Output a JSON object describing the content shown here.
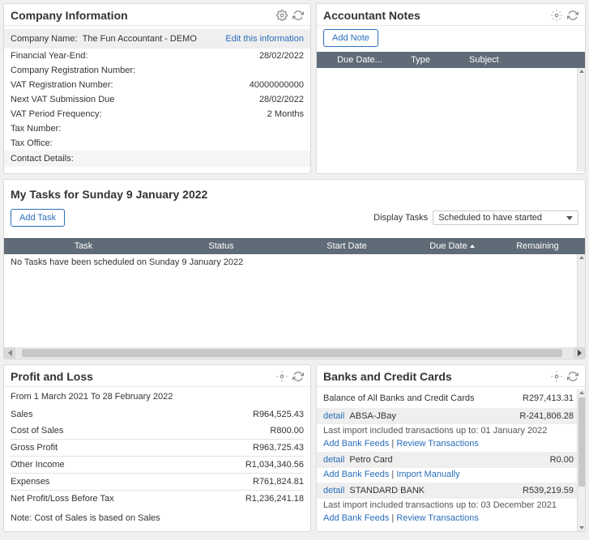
{
  "companyInfo": {
    "title": "Company Information",
    "nameLabel": "Company Name:",
    "nameValue": "The Fun Accountant - DEMO",
    "editLink": "Edit this information",
    "rows": [
      {
        "label": "Financial Year-End:",
        "value": "28/02/2022"
      },
      {
        "label": "Company Registration Number:",
        "value": ""
      },
      {
        "label": "VAT Registration Number:",
        "value": "40000000000"
      },
      {
        "label": "Next VAT Submission Due",
        "value": "28/02/2022"
      },
      {
        "label": "VAT Period Frequency:",
        "value": "2 Months"
      },
      {
        "label": "Tax Number:",
        "value": ""
      },
      {
        "label": "Tax Office:",
        "value": ""
      },
      {
        "label": "Contact Details:",
        "value": ""
      }
    ]
  },
  "accountantNotes": {
    "title": "Accountant Notes",
    "addNote": "Add Note",
    "columns": {
      "dueDate": "Due Date...",
      "type": "Type",
      "subject": "Subject"
    }
  },
  "tasks": {
    "title": "My Tasks for Sunday 9 January 2022",
    "addTask": "Add Task",
    "displayLabel": "Display Tasks",
    "displayValue": "Scheduled to have started",
    "columns": {
      "task": "Task",
      "status": "Status",
      "startDate": "Start Date",
      "dueDate": "Due Date",
      "remaining": "Remaining"
    },
    "empty": "No Tasks have been scheduled on Sunday 9 January 2022"
  },
  "pl": {
    "title": "Profit and Loss",
    "period": "From 1 March 2021 To 28 February 2022",
    "lines": {
      "sales": {
        "label": "Sales",
        "value": "R964,525.43"
      },
      "cos": {
        "label": "Cost of Sales",
        "value": "R800.00"
      },
      "gross": {
        "label": "Gross Profit",
        "value": "R963,725.43"
      },
      "other": {
        "label": "Other Income",
        "value": "R1,034,340.56"
      },
      "exp": {
        "label": "Expenses",
        "value": "R761,824.81"
      },
      "net": {
        "label": "Net Profit/Loss Before Tax",
        "value": "R1,236,241.18"
      }
    },
    "note": "Note: Cost of Sales is based on Sales"
  },
  "banks": {
    "title": "Banks and Credit Cards",
    "balanceLabel": "Balance of All Banks and Credit Cards",
    "balanceValue": "R297,413.31",
    "detailLabel": "detail",
    "addBankFeeds": "Add Bank Feeds",
    "reviewTx": "Review Transactions",
    "importManually": "Import Manually",
    "sep": " | ",
    "accounts": [
      {
        "name": "ABSA-JBay",
        "value": "R-241,806.28",
        "sub": "Last import included transactions up to: 01 January 2022",
        "actions": "review"
      },
      {
        "name": "Petro Card",
        "value": "R0.00",
        "sub": "",
        "actions": "import"
      },
      {
        "name": "STANDARD BANK",
        "value": "R539,219.59",
        "sub": "Last import included transactions up to: 03 December 2021",
        "actions": "review"
      }
    ]
  }
}
